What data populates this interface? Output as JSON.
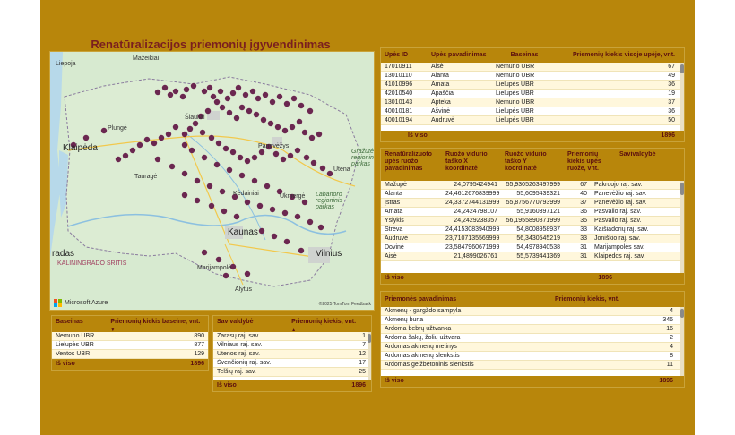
{
  "title": "Renatūralizacijos priemonių įgyvendinimas",
  "map": {
    "labels": {
      "liepoja": "Liepoja",
      "mazeikiai": "Mažeikiai",
      "plunge": "Plungė",
      "klaipeda": "Klaipėda",
      "siauliai": "Šiauliai",
      "panevezys": "Panevėžys",
      "utena": "Utena",
      "grazute": "Gražutė regioninis parkas",
      "taurage": "Tauragė",
      "kedainiai": "Kėdainiai",
      "ukmerge": "Ukmergė",
      "labanoro": "Labanoro regioninis parkas",
      "kaunas": "Kaunas",
      "vilnius": "Vilnius",
      "radas": "radas",
      "kaliningrad": "KALININGRADO SRITIS",
      "marijampole": "Marijampolė",
      "alytus": "Alytus"
    },
    "attribution": "Microsoft Azure",
    "copyright": "©2025 TomTom Feedback"
  },
  "rivers_table": {
    "headers": [
      "Upės ID",
      "Upės pavadinimas",
      "Baseinas",
      "Priemonių kiekis visoje upėje, vnt."
    ],
    "rows": [
      [
        "17010911",
        "Aisė",
        "Nemuno UBR",
        "67"
      ],
      [
        "13010110",
        "Alanta",
        "Nemuno UBR",
        "49"
      ],
      [
        "41010996",
        "Amata",
        "Lielupės UBR",
        "36"
      ],
      [
        "42010540",
        "Apaščia",
        "Lielupės UBR",
        "19"
      ],
      [
        "13010143",
        "Apteka",
        "Nemuno UBR",
        "37"
      ],
      [
        "40010181",
        "Ašvinė",
        "Lielupės UBR",
        "36"
      ],
      [
        "40010194",
        "Audruvė",
        "Lielupės UBR",
        "50"
      ]
    ],
    "total_label": "Iš viso",
    "total_value": "1896"
  },
  "segments_table": {
    "headers": [
      "Renatūralizuoto upės ruožo pavadinimas",
      "Ruožo vidurio taško X koordinatė",
      "Ruožo vidurio taško Y koordinatė",
      "Priemonių kiekis upės ruože, vnt.",
      "Savivaldybė"
    ],
    "rows": [
      [
        "Mažupė",
        "24,0795424941",
        "55,9305263497999",
        "67",
        "Pakruojo raj. sav."
      ],
      [
        "Alanta",
        "24,4612676839999",
        "55,6095439321",
        "40",
        "Panevėžio raj. sav."
      ],
      [
        "Įstras",
        "24,3372744131999",
        "55,8756770793999",
        "37",
        "Panevėžio raj. sav."
      ],
      [
        "Amata",
        "24,2424798107",
        "55,9160397121",
        "36",
        "Pasvalio raj. sav."
      ],
      [
        "Ysiykis",
        "24,2429238357",
        "56,1955890871999",
        "35",
        "Pasvalio raj. sav."
      ],
      [
        "Strėva",
        "24,4153083940999",
        "54,8008958937",
        "33",
        "Kaišiadorių raj. sav."
      ],
      [
        "Audruvė",
        "23,7107135569999",
        "56,3430545219",
        "33",
        "Joniškio raj. sav."
      ],
      [
        "Dovinė",
        "23,5847960671999",
        "54,4978940538",
        "31",
        "Marijampolės sav."
      ],
      [
        "Aisė",
        "21,4899026761",
        "55,5739441369",
        "31",
        "Klaipėdos raj. sav."
      ]
    ],
    "total_label": "Iš viso",
    "total_value": "1896"
  },
  "measures_table": {
    "headers": [
      "Priemonės pavadinimas",
      "Priemonių kiekis, vnt."
    ],
    "rows": [
      [
        "Akmenų - gargždo sampyla",
        "4"
      ],
      [
        "Akmenų buna",
        "346"
      ],
      [
        "Ardoma bebrų užtvanka",
        "16"
      ],
      [
        "Ardoma šakų, žolių užtvara",
        "2"
      ],
      [
        "Ardomas akmenų metinys",
        "4"
      ],
      [
        "Ardomas akmenų slenkstis",
        "8"
      ],
      [
        "Ardomas gelžbetoninis slenkstis",
        "11"
      ]
    ],
    "total_label": "Iš viso",
    "total_value": "1896"
  },
  "basin_table": {
    "headers": [
      "Baseinas",
      "Priemonių kiekis baseine, vnt."
    ],
    "rows": [
      [
        "Nemuno UBR",
        "890"
      ],
      [
        "Lielupės UBR",
        "877"
      ],
      [
        "Ventos UBR",
        "129"
      ]
    ],
    "total_label": "Iš viso",
    "total_value": "1896"
  },
  "municipality_table": {
    "headers": [
      "Savivaldybė",
      "Priemonių kiekis, vnt."
    ],
    "rows": [
      [
        "Zarasų raj. sav.",
        "1"
      ],
      [
        "Vilniaus raj. sav.",
        "7"
      ],
      [
        "Utenos raj. sav.",
        "12"
      ],
      [
        "Švenčionių raj. sav.",
        "17"
      ],
      [
        "Telšių raj. sav.",
        "25"
      ]
    ],
    "total_label": "Iš viso",
    "total_value": "1896"
  },
  "colors": {
    "background": "#b8860b",
    "title": "#7a1f1f",
    "marker": "#6b2750"
  }
}
